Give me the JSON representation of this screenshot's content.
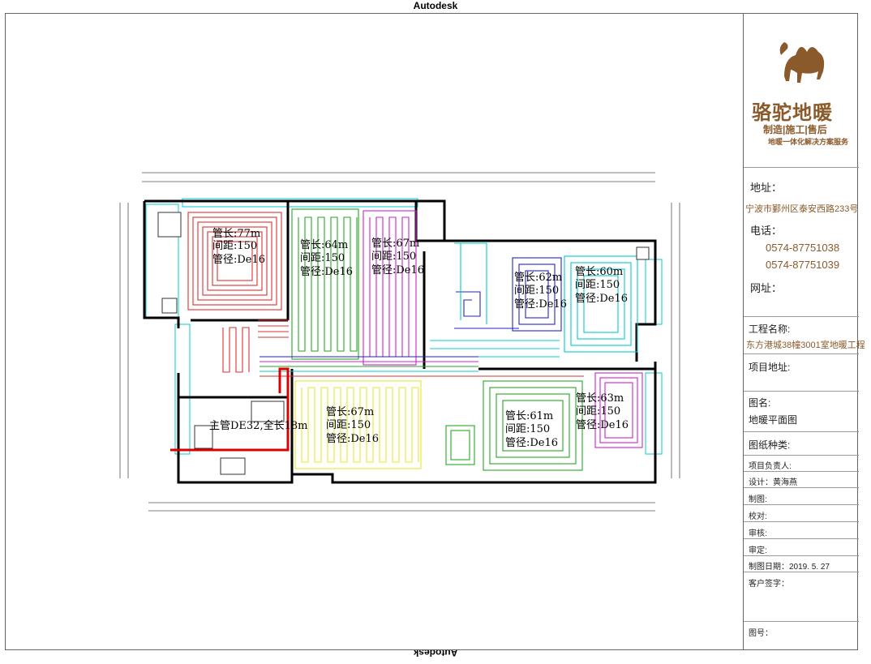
{
  "header": {
    "stamp_top": "Autodesk",
    "stamp_bottom": "Autodesk"
  },
  "rooms": [
    {
      "id": "r1",
      "length": "管长:77m",
      "spacing": "间距:150",
      "diameter": "管径:De16"
    },
    {
      "id": "r2",
      "length": "管长:64m",
      "spacing": "间距:150",
      "diameter": "管径:De16"
    },
    {
      "id": "r3",
      "length": "管长:67m",
      "spacing": "间距:150",
      "diameter": "管径:De16"
    },
    {
      "id": "r4",
      "length": "管长:62m",
      "spacing": "间距:150",
      "diameter": "管径:De16"
    },
    {
      "id": "r5",
      "length": "管长:60m",
      "spacing": "间距:150",
      "diameter": "管径:De16"
    },
    {
      "id": "r6",
      "length": "管长:67m",
      "spacing": "间距:150",
      "diameter": "管径:De16"
    },
    {
      "id": "r7",
      "length": "管长:61m",
      "spacing": "间距:150",
      "diameter": "管径:De16"
    },
    {
      "id": "r8",
      "length": "管长:63m",
      "spacing": "间距:150",
      "diameter": "管径:De16"
    }
  ],
  "main_pipe": "主管DE32,全长18m",
  "title_block": {
    "brand_name": "骆驼地暖",
    "brand_sub": "制造|施工|售后",
    "brand_tagline": "地暖一体化解决方案服务",
    "address_label": "地址：",
    "address": "宁波市鄞州区泰安西路233号",
    "phone_label": "电话：",
    "phone1": "0574-87751038",
    "phone2": "0574-87751039",
    "web_label": "网址：",
    "project_name_label": "工程名称:",
    "project_name": "东方港城38幢3001室地暖工程",
    "project_addr_label": "项目地址:",
    "drawing_name_label": "图名:",
    "drawing_name": "地暖平面图",
    "drawing_type_label": "图纸种类:",
    "manager": "项目负责人:",
    "designer": "设计：黄海燕",
    "drafter": "制图:",
    "checker": "校对:",
    "reviewer": "审核:",
    "approver": "审定:",
    "date": "制图日期：2019. 5. 27",
    "client_sign": "客户签字：",
    "drawing_no": "图号："
  },
  "colors": {
    "wall": "#000000",
    "cyan": "#00cccc",
    "red": "#e03030",
    "green": "#22aa22",
    "magenta": "#cc22cc",
    "yellow": "#e8e830",
    "blue": "#2222cc",
    "brand": "#8a5a2b",
    "main_pipe": "#dd0000"
  }
}
